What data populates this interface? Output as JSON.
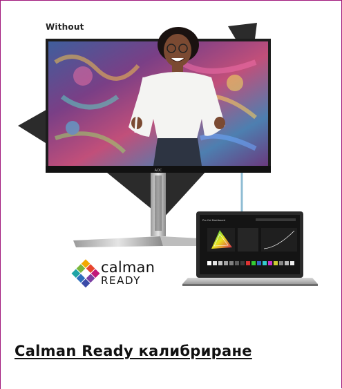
{
  "comparison_label": "Without",
  "monitor_logo": "AOC",
  "calman_logo": {
    "word1": "calman",
    "word2": "READY"
  },
  "laptop_screen_title": "Pro Cal Dashboard",
  "heading": "Calman Ready калибриране",
  "colors": {
    "frame_border": "#a0167a",
    "backdrop_triangle": "#2b2b2b",
    "connector_cable": "#8fbcd3"
  }
}
